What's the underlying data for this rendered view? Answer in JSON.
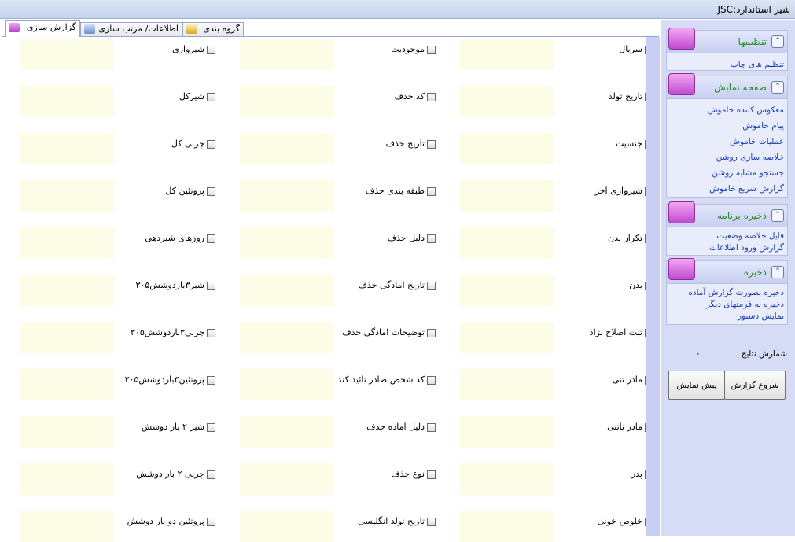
{
  "window": {
    "title": "شیر استاندارد:JSC"
  },
  "tabs": [
    {
      "label": "گزارش سازی"
    },
    {
      "label": "اطلاعات/ مرتب سازی"
    },
    {
      "label": "گروه بندی"
    }
  ],
  "columns": [
    [
      "سریال",
      "تاریخ تولد",
      "جنسیت",
      "شیرواری آخر",
      "تکرار بدن",
      "بدن",
      "ثبت اصلاح نژاد",
      "مادر تنی",
      "مادر ناتنی",
      "پدر",
      "خلوص خونی"
    ],
    [
      "موجودیت",
      "کد حذف",
      "تاریخ حذف",
      "طبقه بندی حذف",
      "دلیل حذف",
      "تاریخ امادگی حذف",
      "توضیحات امادگی حذف",
      "کد شخص صادر تائید کند",
      "دلیل آماده حذف",
      "نوع حذف",
      "تاریخ تولد انگلیسی"
    ],
    [
      "شیرواری",
      "شیرکل",
      "چربی کل",
      "پروتئین کل",
      "روزهای شیردهی",
      "شیر۳باردوشش۳۰۵",
      "چربی۳باردوشش۳۰۵",
      "پروتئین۳باردوشش۳۰۵",
      "شیر ۲ بار دوشش",
      "چربی ۲ بار دوشش",
      "پروتئین دو بار دوشش"
    ]
  ],
  "sidebar": {
    "settings": {
      "title": "تنظیمها",
      "links": [
        "تنظیم های چاپ"
      ]
    },
    "display": {
      "title": "صفحه نمایش",
      "links": [
        "معکوس کننده خاموش",
        "پیام خاموش",
        "عملیات خاموش",
        "خلاصه سازی روشن",
        "جستجو مشابه روشن",
        "گزارش سریع خاموش"
      ]
    },
    "save_program": {
      "title": "ذخیره برنامه",
      "links": [
        "فایل خلاصه وضعیت",
        "گزارش ورود اطلاعات"
      ]
    },
    "save": {
      "title": "ذخیره",
      "links": [
        "ذخیره بصورت گزارش آماده",
        "ذخیره به فرمتهای دیگر",
        "نمایش دستور"
      ]
    },
    "count_label": "شمارش نتایج",
    "count_value": "۰",
    "start_button": "شروع گزارش",
    "preview_button": "پیش نمایش"
  }
}
